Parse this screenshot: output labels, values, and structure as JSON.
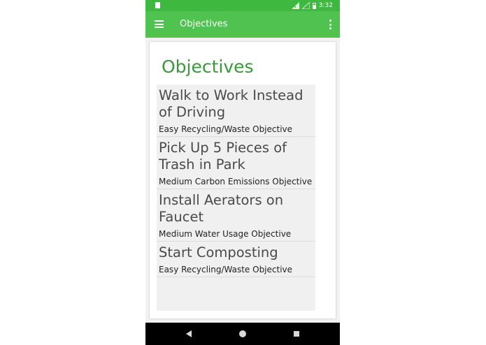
{
  "status_bar": {
    "time": "3:32"
  },
  "app_bar": {
    "title": "Objectives"
  },
  "page": {
    "heading": "Objectives"
  },
  "objectives": [
    {
      "title": "Walk to Work Instead of Driving",
      "subtitle": "Easy Recycling/Waste Objective"
    },
    {
      "title": "Pick Up 5 Pieces of Trash in Park",
      "subtitle": "Medium Carbon Emissions Objective"
    },
    {
      "title": "Install Aerators on Faucet",
      "subtitle": "Medium Water Usage Objective"
    },
    {
      "title": "Start Composting",
      "subtitle": "Easy Recycling/Waste Objective"
    }
  ],
  "icons": {
    "status_left": "sim-card-icon",
    "signal": "signal-icon",
    "wifi": "wifi-icon",
    "battery": "battery-icon",
    "menu": "hamburger-menu-icon",
    "overflow": "more-vert-icon",
    "back": "back-triangle-icon",
    "home": "home-circle-icon",
    "recents": "recents-square-icon"
  },
  "colors": {
    "status_bar": "#3fb83f",
    "app_bar": "#4fc24f",
    "heading": "#3a9a3a",
    "list_bg": "#f0f0f0",
    "nav_bar": "#000000"
  }
}
